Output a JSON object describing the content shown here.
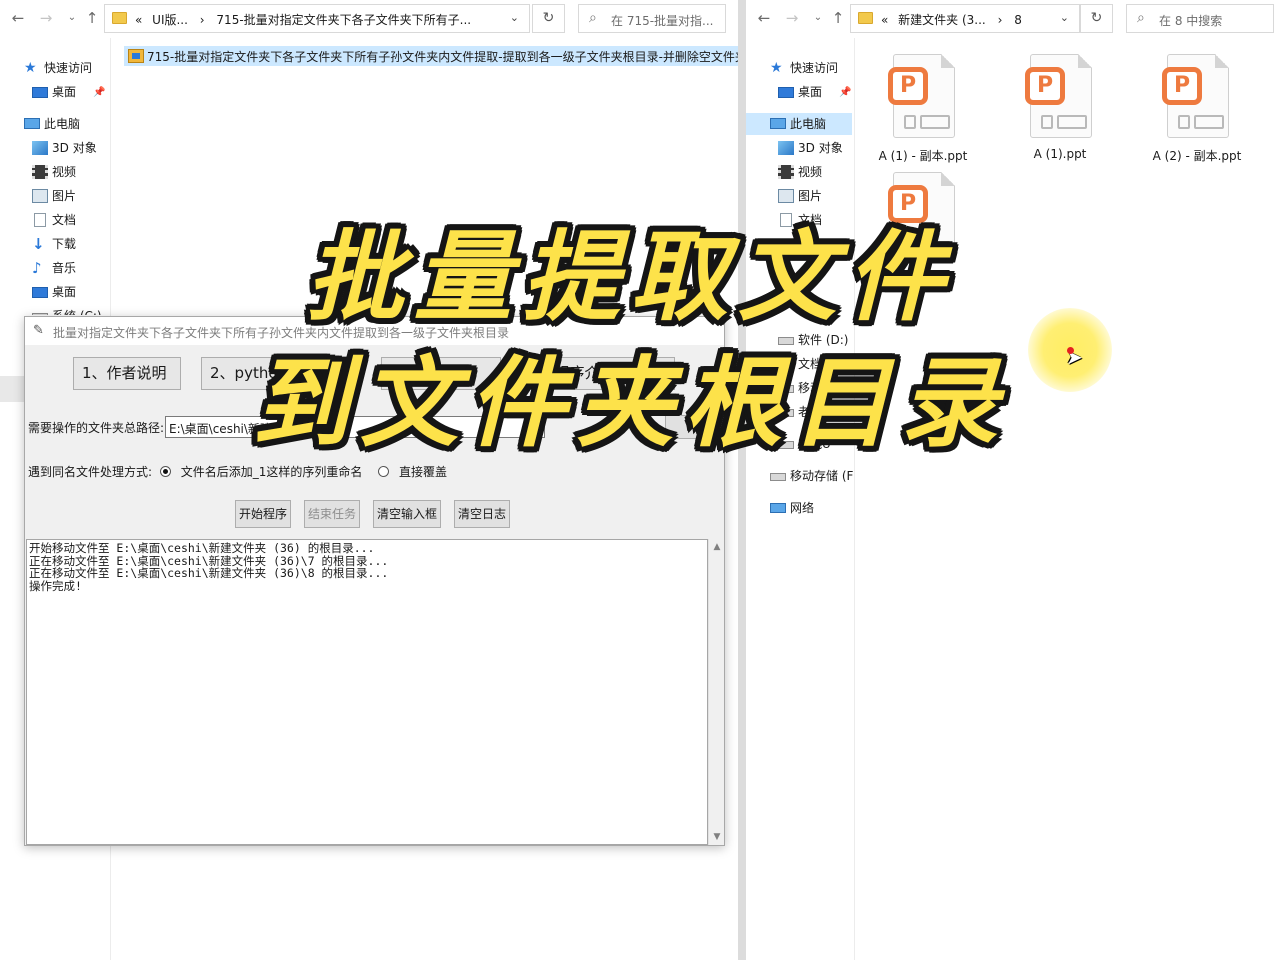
{
  "left_explorer": {
    "breadcrumb_prefix": "«",
    "breadcrumb_1": "UI版...",
    "breadcrumb_2": "715-批量对指定文件夹下各子文件夹下所有子...",
    "search_placeholder": "在 715-批量对指...",
    "selected_file": "715-批量对指定文件夹下各子文件夹下所有子孙文件夹内文件提取-提取到各一级子文件夹根目录-并删除空文件夹",
    "nav": {
      "quick_access": "快速访问",
      "desktop": "桌面",
      "this_pc": "此电脑",
      "objects3d": "3D 对象",
      "videos": "视频",
      "pictures": "图片",
      "documents": "文档",
      "downloads": "下载",
      "music": "音乐",
      "desktop2": "桌面",
      "system_partial": "系统 (C:)"
    }
  },
  "right_explorer": {
    "breadcrumb_prefix": "«",
    "breadcrumb_1": "新建文件夹 (3...",
    "breadcrumb_2": "8",
    "search_placeholder": "在 8 中搜索",
    "nav": {
      "quick_access": "快速访问",
      "desktop": "桌面",
      "this_pc": "此电脑",
      "objects3d": "3D 对象",
      "videos": "视频",
      "pictures": "图片",
      "documents": "文档",
      "software_partial": "软件 (D:)",
      "docs_drive": "文档 (E:)",
      "move_partial": "移动",
      "old_partial": "老",
      "maomao_partial": "毛桃U",
      "removable": "移动存储 (F",
      "network": "网络"
    },
    "files": [
      {
        "name": "A (1) - 副本.ppt"
      },
      {
        "name": "A (1).ppt"
      },
      {
        "name": "A (2) - 副本.ppt"
      },
      {
        "name": ""
      }
    ]
  },
  "dialog": {
    "title": "批量对指定文件夹下各子文件夹下所有子孙文件夹内文件提取到各一级子文件夹根目录",
    "top_buttons": [
      {
        "label": "1、作者说明"
      },
      {
        "label": "2、python程序定制"
      },
      {
        "label": "3、更多程序"
      },
      {
        "label": "4、程序介绍"
      }
    ],
    "path_label": "需要操作的文件夹总路径:",
    "path_value": "E:\\桌面\\ceshi\\新建文件夹 (36)",
    "conflict_label": "遇到同名文件处理方式:",
    "option_rename": "文件名后添加_1这样的序列重命名",
    "option_overwrite": "直接覆盖",
    "buttons": {
      "start": "开始程序",
      "stop": "结束任务",
      "clear_input": "清空输入框",
      "clear_log": "清空日志"
    },
    "log": "开始移动文件至 E:\\桌面\\ceshi\\新建文件夹 (36) 的根目录...\n正在移动文件至 E:\\桌面\\ceshi\\新建文件夹 (36)\\7 的根目录...\n正在移动文件至 E:\\桌面\\ceshi\\新建文件夹 (36)\\8 的根目录...\n操作完成!"
  },
  "overlay": {
    "line1": "批量提取文件",
    "line2": "到文件夹根目录"
  },
  "colors": {
    "overlay_fill": "#fde24a",
    "overlay_stroke": "#151515",
    "ppt_accent": "#ee7a3f",
    "selection": "#cce8ff"
  }
}
